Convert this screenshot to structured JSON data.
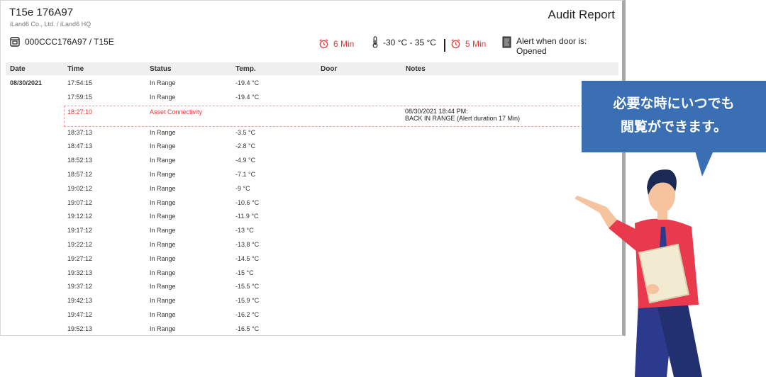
{
  "header": {
    "device_title": "T15e 176A97",
    "company": "iLand6 Co., Ltd. / iLand6 HQ",
    "report_title": "Audit Report",
    "device_id": "000CCC176A97 / T15E"
  },
  "metrics": {
    "alarm_delay_1": "6 Min",
    "temp_range": "-30 °C - 35 °C",
    "alarm_delay_2": "5 Min",
    "door_alert": "Alert when door is: Opened",
    "icons": [
      "alarm-clock-icon",
      "thermometer-icon",
      "alarm-clock-icon",
      "door-icon"
    ],
    "alert_color": "#e53935"
  },
  "table": {
    "columns": [
      "Date",
      "Time",
      "Status",
      "Temp.",
      "Door",
      "Notes"
    ],
    "rows": [
      {
        "date": "08/30/2021",
        "time": "17:54:15",
        "status": "In Range",
        "temp": "-19.4 °C",
        "notes": ""
      },
      {
        "date": "",
        "time": "17:59:15",
        "status": "In Range",
        "temp": "-19.4 °C",
        "notes": ""
      },
      {
        "date": "",
        "time": "18:27:10",
        "status": "Asset Connectivity",
        "temp": "",
        "notes": "08/30/2021 18:44 PM:",
        "notes2": "BACK IN RANGE (Alert duration 17 Min)",
        "alert": true
      },
      {
        "date": "",
        "time": "18:37:13",
        "status": "In Range",
        "temp": "-3.5 °C",
        "notes": ""
      },
      {
        "date": "",
        "time": "18:47:13",
        "status": "In Range",
        "temp": "-2.8 °C",
        "notes": ""
      },
      {
        "date": "",
        "time": "18:52:13",
        "status": "In Range",
        "temp": "-4.9 °C",
        "notes": ""
      },
      {
        "date": "",
        "time": "18:57:12",
        "status": "In Range",
        "temp": "-7.1 °C",
        "notes": ""
      },
      {
        "date": "",
        "time": "19:02:12",
        "status": "In Range",
        "temp": "-9 °C",
        "notes": ""
      },
      {
        "date": "",
        "time": "19:07:12",
        "status": "In Range",
        "temp": "-10.6 °C",
        "notes": ""
      },
      {
        "date": "",
        "time": "19:12:12",
        "status": "In Range",
        "temp": "-11.9 °C",
        "notes": ""
      },
      {
        "date": "",
        "time": "19:17:12",
        "status": "In Range",
        "temp": "-13 °C",
        "notes": ""
      },
      {
        "date": "",
        "time": "19:22:12",
        "status": "In Range",
        "temp": "-13.8 °C",
        "notes": ""
      },
      {
        "date": "",
        "time": "19:27:12",
        "status": "In Range",
        "temp": "-14.5 °C",
        "notes": ""
      },
      {
        "date": "",
        "time": "19:32:13",
        "status": "In Range",
        "temp": "-15 °C",
        "notes": ""
      },
      {
        "date": "",
        "time": "19:37:12",
        "status": "In Range",
        "temp": "-15.5 °C",
        "notes": ""
      },
      {
        "date": "",
        "time": "19:42:13",
        "status": "In Range",
        "temp": "-15.9 °C",
        "notes": ""
      },
      {
        "date": "",
        "time": "19:47:12",
        "status": "In Range",
        "temp": "-16.2 °C",
        "notes": ""
      },
      {
        "date": "",
        "time": "19:52:13",
        "status": "In Range",
        "temp": "-16.5 °C",
        "notes": ""
      }
    ]
  },
  "callout": {
    "line1": "必要な時にいつでも",
    "line2": "閲覧ができます。",
    "color": "#3a6fb3"
  }
}
